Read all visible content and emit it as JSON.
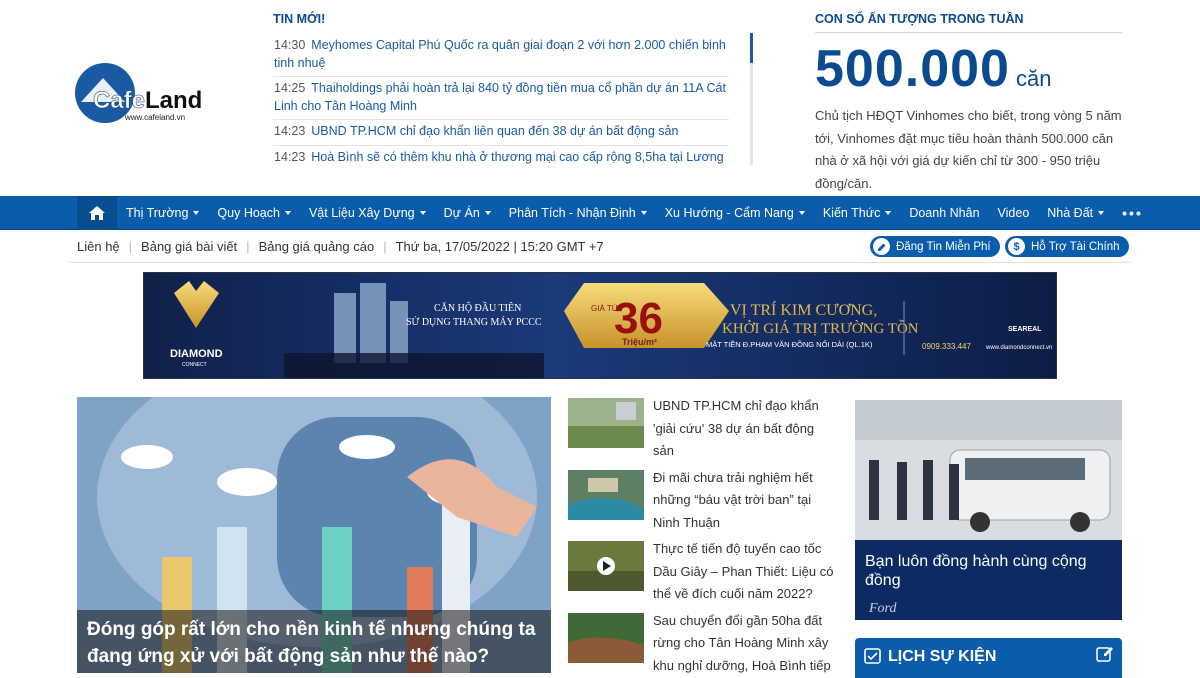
{
  "logo": {
    "name": "CafeLand",
    "url_text": "www.cafeland.vn"
  },
  "ticker": {
    "title": "TIN MỚI!",
    "items": [
      {
        "time": "14:30",
        "text": "Meyhomes Capital Phú Quốc ra quân giai đoạn 2 với hơn 2.000 chiến binh tinh nhuệ"
      },
      {
        "time": "14:25",
        "text": "Thaiholdings phải hoàn trả lại 840 tỷ đồng tiền mua cổ phần dự án 11A Cát Linh cho Tân Hoàng Minh"
      },
      {
        "time": "14:23",
        "text": "UBND TP.HCM chỉ đạo khẩn liên quan đến 38 dự án bất động sản"
      },
      {
        "time": "14:23",
        "text": "Hoà Bình sẽ có thêm khu nhà ở thương mại cao cấp rộng 8,5ha tại Lương"
      }
    ]
  },
  "stat": {
    "title": "CON SỐ ẤN TƯỢNG TRONG TUẦN",
    "number": "500.000",
    "unit": "căn",
    "description": "Chủ tịch HĐQT Vinhomes cho biết, trong vòng 5 năm tới, Vinhomes đặt mục tiêu hoàn thành 500.000 căn nhà ở xã hội với giá dự kiến chỉ từ 300 - 950 triệu đồng/căn."
  },
  "nav": {
    "items": [
      {
        "label": "Thị Trường",
        "dropdown": true
      },
      {
        "label": "Quy Hoạch",
        "dropdown": true
      },
      {
        "label": "Vật Liệu Xây Dựng",
        "dropdown": true
      },
      {
        "label": "Dự Án",
        "dropdown": true
      },
      {
        "label": "Phân Tích - Nhận Định",
        "dropdown": true
      },
      {
        "label": "Xu Hướng - Cẩm Nang",
        "dropdown": true
      },
      {
        "label": "Kiến Thức",
        "dropdown": true
      },
      {
        "label": "Doanh Nhân",
        "dropdown": false
      },
      {
        "label": "Video",
        "dropdown": false
      },
      {
        "label": "Nhà Đất",
        "dropdown": true
      }
    ],
    "more": "•••"
  },
  "subbar": {
    "contact": "Liên hệ",
    "price_post": "Bảng giá bài viết",
    "price_ads": "Bảng giá quảng cáo",
    "datetime": "Thứ ba, 17/05/2022 | 15:20 GMT +7",
    "post_free": "Đăng Tin Miễn Phí",
    "finance": "Hỗ Trợ Tài Chính"
  },
  "banner": {
    "brand": "DIAMOND",
    "brand_sub": "CONNECT",
    "tagline1": "CĂN HỘ ĐẦU TIÊN",
    "tagline2": "SỬ DỤNG THANG MÁY PCCC",
    "price_prefix": "GIÁ TỪ",
    "price": "36",
    "price_unit": "Triệu/m²",
    "headline1": "VỊ TRÍ KIM CƯƠNG,",
    "headline2": "KHỞI GIÁ TRỊ TRƯỜNG TỒN",
    "address": "MẶT TIỀN Đ.PHẠM VĂN ĐỒNG NỐI DÀI (QL.1K)",
    "phone": "0909.333.447",
    "web": "www.diamondconnect.vn",
    "partner": "SEAREAL"
  },
  "feature": {
    "caption": "Đóng góp rất lớn cho nền kinh tế nhưng chúng ta đang ứng xử với bất động sản như thế nào?"
  },
  "side_news": [
    {
      "text": "UBND TP.HCM chỉ đạo khẩn 'giải cứu' 38 dự án bất động sản"
    },
    {
      "text": "Đi mãi chưa trải nghiệm hết những “báu vật trời ban” tại Ninh Thuận"
    },
    {
      "text": "Thực tế tiến độ tuyến cao tốc Dầu Giây – Phan Thiết: Liệu có thể về đích cuối năm 2022?"
    },
    {
      "text": "Sau chuyển đổi gần 50ha đất rừng cho Tân Hoàng Minh xây khu nghỉ dưỡng, Hoà Bình tiếp"
    }
  ],
  "ford_ad": {
    "text": "Bạn luôn đồng hành cùng cộng đồng",
    "brand": "Ford"
  },
  "events": {
    "title": "LỊCH SỰ KIỆN"
  },
  "colors": {
    "brand_blue": "#0b5cab",
    "dark_blue": "#0b4a8f",
    "link_blue": "#1a5aa3"
  }
}
